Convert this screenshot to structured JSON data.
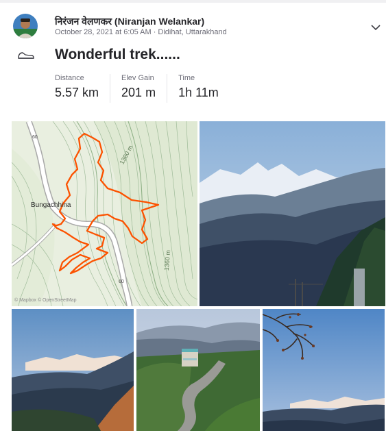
{
  "athlete": {
    "name": "निरंजन वेलणकर (Niranjan Welankar)",
    "meta": "October 28, 2021 at 6:05 AM · Didihat, Uttarakhand"
  },
  "activity": {
    "sport_icon": "shoe-icon",
    "title": "Wonderful trek......",
    "stats": [
      {
        "label": "Distance",
        "value": "5.57 km"
      },
      {
        "label": "Elev Gain",
        "value": "201 m"
      },
      {
        "label": "Time",
        "value": "1h 11m"
      }
    ]
  },
  "map": {
    "town": "Bungachhina",
    "contour_a": "1360 m",
    "contour_b": "1360 m",
    "road_a": "60",
    "road_b": "60",
    "attribution": "© Mapbox © OpenStreetMap",
    "route_color": "#fc5200"
  },
  "colors": {
    "accent": "#fc5200",
    "text_primary": "#242428",
    "text_secondary": "#6d6d78"
  }
}
